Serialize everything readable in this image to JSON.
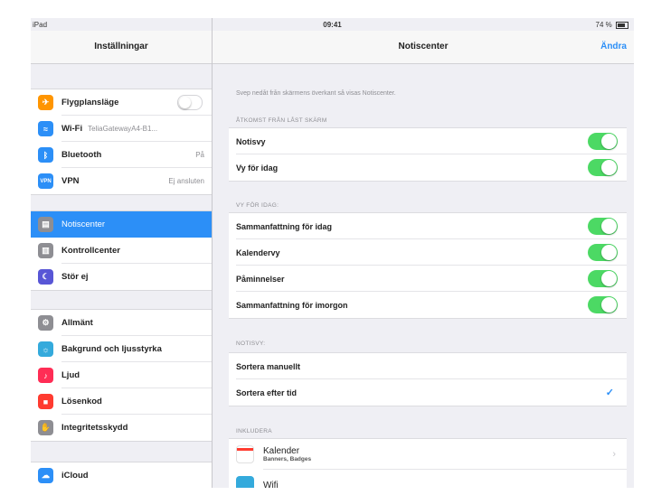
{
  "status_bar": {
    "carrier": "iPad",
    "time": "09:41",
    "battery": "74 %"
  },
  "sidebar": {
    "title": "Inställningar",
    "groups": [
      [
        {
          "label": "Flygplansläge",
          "icon": "airplane-icon",
          "color": "#ff9500",
          "glyph": "✈",
          "toggle": "off"
        },
        {
          "label": "Wi-Fi",
          "value": "TeliaGatewayA4-B1...",
          "icon": "wifi-icon",
          "color": "#2c8ff7",
          "glyph": "≈"
        },
        {
          "label": "Bluetooth",
          "value": "På",
          "icon": "bluetooth-icon",
          "color": "#2c8ff7",
          "glyph": "ᛒ"
        },
        {
          "label": "VPN",
          "value": "Ej ansluten",
          "icon": "vpn-icon",
          "color": "#2c8ff7",
          "glyph": "VPN"
        }
      ],
      [
        {
          "label": "Notiscenter",
          "icon": "notification-center-icon",
          "color": "#8e8e93",
          "glyph": "▤",
          "selected": true
        },
        {
          "label": "Kontrollcenter",
          "icon": "control-center-icon",
          "color": "#8e8e93",
          "glyph": "▥"
        },
        {
          "label": "Stör ej",
          "icon": "do-not-disturb-icon",
          "color": "#5856d6",
          "glyph": "☾"
        }
      ],
      [
        {
          "label": "Allmänt",
          "icon": "gear-icon",
          "color": "#8e8e93",
          "glyph": "⚙"
        },
        {
          "label": "Bakgrund och ljusstyrka",
          "icon": "brightness-icon",
          "color": "#34aadc",
          "glyph": "☼"
        },
        {
          "label": "Ljud",
          "icon": "sound-icon",
          "color": "#ff2d55",
          "glyph": "♪"
        },
        {
          "label": "Lösenkod",
          "icon": "lock-icon",
          "color": "#ff3b30",
          "glyph": "■"
        },
        {
          "label": "Integritetsskydd",
          "icon": "privacy-icon",
          "color": "#8e8e93",
          "glyph": "✋"
        }
      ],
      [
        {
          "label": "iCloud",
          "icon": "icloud-icon",
          "color": "#2c8ff7",
          "glyph": "☁"
        }
      ]
    ]
  },
  "detail": {
    "title": "Notiscenter",
    "edit_label": "Ändra",
    "note": "Svep nedåt från skärmens överkant så visas Notiscenter.",
    "sections": [
      {
        "header": "ÅTKOMST FRÅN LÅST SKÄRM",
        "rows": [
          {
            "label": "Notisvy",
            "toggle": "on"
          },
          {
            "label": "Vy för idag",
            "toggle": "on"
          }
        ]
      },
      {
        "header": "VY FÖR IDAG:",
        "rows": [
          {
            "label": "Sammanfattning för idag",
            "toggle": "on"
          },
          {
            "label": "Kalendervy",
            "toggle": "on"
          },
          {
            "label": "Påminnelser",
            "toggle": "on"
          },
          {
            "label": "Sammanfattning för imorgon",
            "toggle": "on"
          }
        ]
      },
      {
        "header": "NOTISVY:",
        "rows": [
          {
            "label": "Sortera manuellt"
          },
          {
            "label": "Sortera efter tid",
            "checked": true
          }
        ]
      },
      {
        "header": "INKLUDERA",
        "apps": [
          {
            "name": "Kalender",
            "sub": "Banners, Badges",
            "icon": "calendar-icon"
          },
          {
            "name": "Wifi",
            "sub": "",
            "icon": "app-icon"
          }
        ]
      }
    ]
  }
}
